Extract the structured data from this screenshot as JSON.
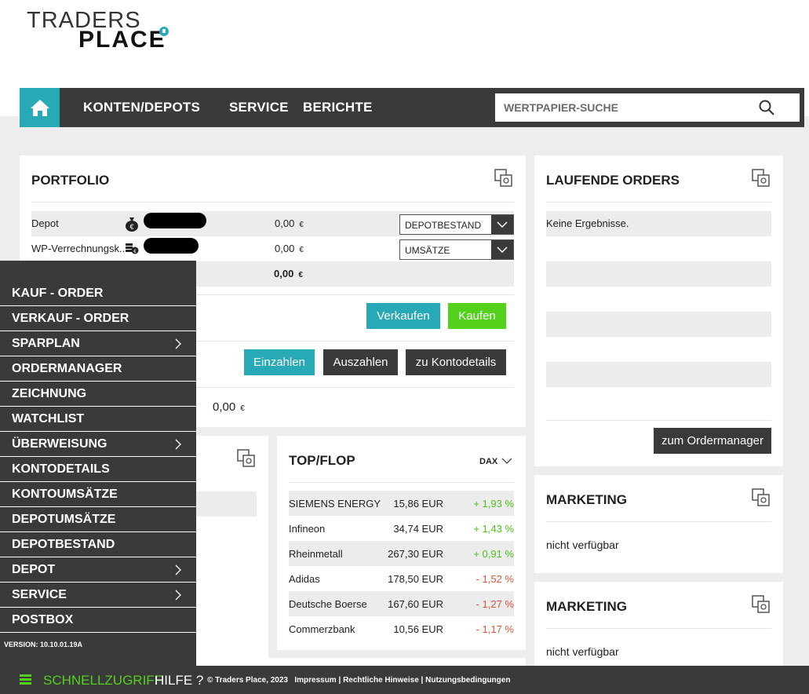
{
  "brand": {
    "line1": "TRADERS",
    "line2": "PLACE",
    "accent": "#27a9b6"
  },
  "nav": {
    "home_icon": "home-icon",
    "items": [
      "KONTEN/DEPOTS",
      "SERVICE",
      "BERICHTE"
    ],
    "search_placeholder": "WERTPAPIER-SUCHE"
  },
  "portfolio": {
    "title": "PORTFOLIO",
    "rows": [
      {
        "label": "Depot",
        "value": "0,00",
        "currency": "€",
        "select": "DEPOTBESTAND"
      },
      {
        "label": "WP-Verrechnungsk...",
        "value": "0,00",
        "currency": "€",
        "select": "UMSÄTZE"
      }
    ],
    "total": {
      "value": "0,00",
      "currency": "€"
    },
    "buttons": {
      "sell": "Verkaufen",
      "buy": "Kaufen",
      "deposit": "Einzahlen",
      "withdraw": "Auszahlen",
      "details": "zu Kontodetails"
    },
    "balance": {
      "value": "0,00",
      "currency": "€"
    }
  },
  "orders": {
    "title": "LAUFENDE ORDERS",
    "empty": "Keine Ergebnisse.",
    "button": "zum Ordermanager"
  },
  "topflop": {
    "title": "TOP/FLOP",
    "index": "DAX",
    "rows": [
      {
        "name": "SIEMENS ENERGY",
        "price": "15,86 EUR",
        "change": "+ 1,93 %",
        "dir": "pos"
      },
      {
        "name": "Infineon",
        "price": "34,74 EUR",
        "change": "+ 1,43 %",
        "dir": "pos"
      },
      {
        "name": "Rheinmetall",
        "price": "267,30 EUR",
        "change": "+ 0,91 %",
        "dir": "pos"
      },
      {
        "name": "Adidas",
        "price": "178,50 EUR",
        "change": "- 1,52 %",
        "dir": "neg"
      },
      {
        "name": "Deutsche Boerse",
        "price": "167,60 EUR",
        "change": "- 1,27 %",
        "dir": "neg"
      },
      {
        "name": "Commerzbank",
        "price": "10,56 EUR",
        "change": "- 1,17 %",
        "dir": "neg"
      }
    ]
  },
  "marketing": [
    {
      "title": "MARKETING",
      "text": "nicht verfügbar"
    },
    {
      "title": "MARKETING",
      "text": "nicht verfügbar"
    }
  ],
  "menu": {
    "items": [
      {
        "label": "KAUF - ORDER",
        "sub": false
      },
      {
        "label": "VERKAUF - ORDER",
        "sub": false
      },
      {
        "label": "SPARPLAN",
        "sub": true
      },
      {
        "label": "ORDERMANAGER",
        "sub": false
      },
      {
        "label": "ZEICHNUNG",
        "sub": false
      },
      {
        "label": "WATCHLIST",
        "sub": false
      },
      {
        "label": "ÜBERWEISUNG",
        "sub": true
      },
      {
        "label": "KONTODETAILS",
        "sub": false
      },
      {
        "label": "KONTOUMSÄTZE",
        "sub": false
      },
      {
        "label": "DEPOTUMSÄTZE",
        "sub": false
      },
      {
        "label": "DEPOTBESTAND",
        "sub": false
      },
      {
        "label": "DEPOT",
        "sub": true
      },
      {
        "label": "SERVICE",
        "sub": true
      },
      {
        "label": "POSTBOX",
        "sub": false
      }
    ],
    "version": "VERSION: 10.10.01.19A"
  },
  "footer": {
    "quick": "SCHNELLZUGRIFF",
    "help": "HILFE ?",
    "copyright": "© Traders Place, 2023",
    "links": [
      "Impressum",
      "Rechtliche Hinweise",
      "Nutzungsbedingungen"
    ]
  },
  "colors": {
    "teal": "#27a9b6",
    "green": "#53d11b",
    "dark": "#3a3a3a",
    "positive": "#4ec21c",
    "negative": "#d9553e"
  }
}
